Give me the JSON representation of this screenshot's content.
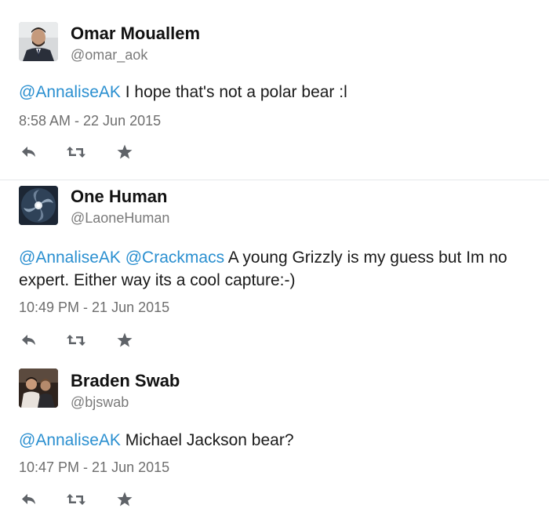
{
  "tweets": [
    {
      "name": "Omar Mouallem",
      "handle": "@omar_aok",
      "mentions": [
        "@AnnaliseAK"
      ],
      "text": " I hope that's not a polar bear :l",
      "time": "8:58 AM - 22 Jun 2015",
      "avatar": "avatar-man-in-suit"
    },
    {
      "name": "One Human",
      "handle": "@LaoneHuman",
      "mentions": [
        "@AnnaliseAK",
        "@Crackmacs"
      ],
      "text": " A young Grizzly is my guess but Im no expert. Either way its a cool capture:-)",
      "time": "10:49 PM - 21 Jun 2015",
      "avatar": "avatar-galaxy"
    },
    {
      "name": "Braden Swab",
      "handle": "@bjswab",
      "mentions": [
        "@AnnaliseAK"
      ],
      "text": " Michael Jackson bear?",
      "time": "10:47 PM - 21 Jun 2015",
      "avatar": "avatar-photo-group"
    }
  ],
  "actions": [
    "reply-icon",
    "retweet-icon",
    "favorite-icon"
  ],
  "colors": {
    "mention": "#2a8fd0",
    "icon": "#5f6368",
    "divider": "#e6e8ea",
    "muted_text": "#7a7a7a"
  }
}
